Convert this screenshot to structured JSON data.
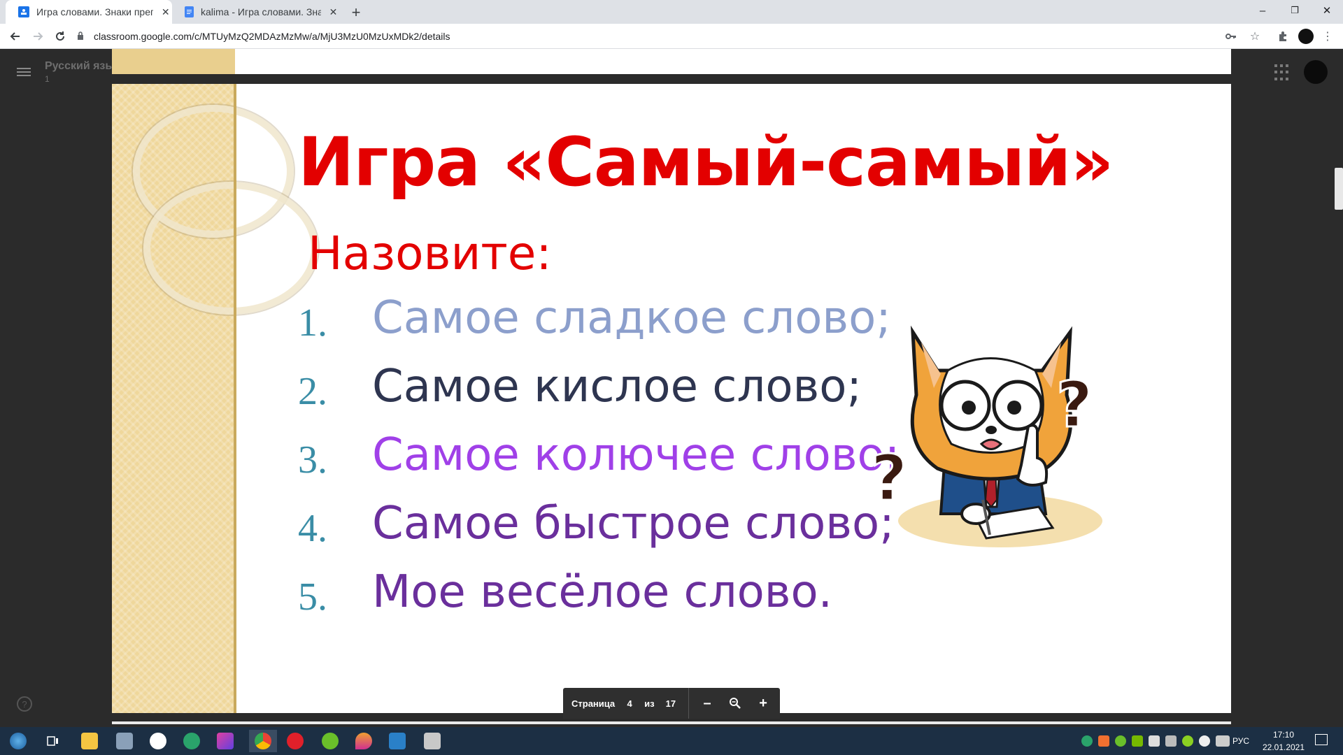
{
  "browser": {
    "tabs": [
      {
        "title": "Игра словами. Знаки препинания",
        "active": true,
        "favicon": "classroom-icon",
        "color": "#1a73e8"
      },
      {
        "title": "kalima - Игра словами. Знаки пр",
        "active": false,
        "favicon": "docs-icon",
        "color": "#4285f4"
      }
    ],
    "new_tab_label": "+",
    "url": "classroom.google.com/c/MTUyMzQ2MDAzMzMw/a/MjU3MzU0MzUxMDk2/details",
    "window_controls": {
      "minimize": "–",
      "maximize": "❐",
      "close": "✕"
    }
  },
  "classroom": {
    "course_name": "Русский язы",
    "course_sub": "1"
  },
  "slide": {
    "title": "Игра «Самый-самый»",
    "subtitle": "Назовите:",
    "items": [
      {
        "num": "1.",
        "text": "Самое сладкое слово;",
        "color": "#8c9fcc"
      },
      {
        "num": "2.",
        "text": "Самое кислое слово;",
        "color": "#2e3550"
      },
      {
        "num": "3.",
        "text": "Самое колючее слово;",
        "color": "#a040e8"
      },
      {
        "num": "4.",
        "text": "Самое быстрое слово;",
        "color": "#6a2f9c"
      },
      {
        "num": "5.",
        "text": "Мое весёлое слово.",
        "color": "#6a2f9c"
      }
    ],
    "title_color": "#e30000",
    "number_color": "#3a8da6"
  },
  "page_toolbar": {
    "page_label": "Страница",
    "current_page": "4",
    "of_label": "из",
    "total_pages": "17",
    "zoom_out": "–",
    "zoom_in": "+"
  },
  "taskbar": {
    "language": "РУС",
    "time": "17:10",
    "date": "22.01.2021"
  }
}
